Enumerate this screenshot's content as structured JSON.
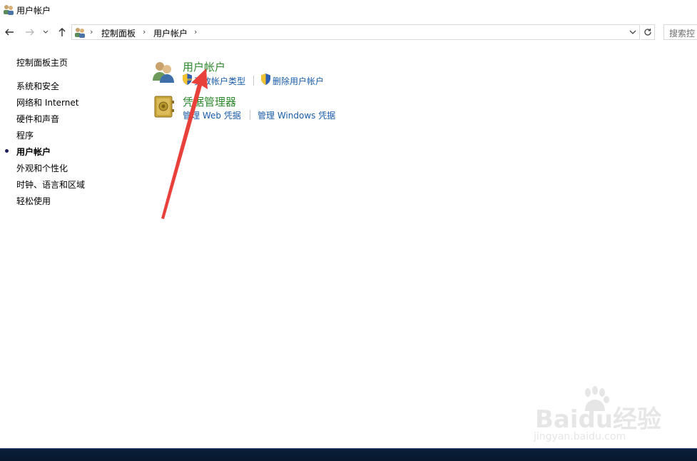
{
  "window": {
    "title": "用户帐户"
  },
  "address": {
    "crumbs": [
      "控制面板",
      "用户帐户"
    ]
  },
  "search": {
    "placeholder": "搜索控"
  },
  "sidebar": {
    "home": "控制面板主页",
    "items": [
      {
        "label": "系统和安全",
        "active": false
      },
      {
        "label": "网络和 Internet",
        "active": false
      },
      {
        "label": "硬件和声音",
        "active": false
      },
      {
        "label": "程序",
        "active": false
      },
      {
        "label": "用户帐户",
        "active": true
      },
      {
        "label": "外观和个性化",
        "active": false
      },
      {
        "label": "时钟、语言和区域",
        "active": false
      },
      {
        "label": "轻松使用",
        "active": false
      }
    ]
  },
  "categories": [
    {
      "title": "用户帐户",
      "icon": "users-icon",
      "links": [
        {
          "label": "更改帐户类型",
          "icon": "uac-shield-icon"
        },
        {
          "label": "删除用户帐户",
          "icon": "uac-shield-icon"
        }
      ]
    },
    {
      "title": "凭据管理器",
      "icon": "credential-vault-icon",
      "links": [
        {
          "label": "管理 Web 凭据"
        },
        {
          "label": "管理 Windows 凭据"
        }
      ]
    }
  ],
  "watermark": {
    "brand": "Baidu经验",
    "url": "jingyan.baidu.com"
  },
  "colors": {
    "category_title": "#2f8a2f",
    "link": "#1a5ca8",
    "annotation_arrow": "#e8413c",
    "taskbar": "#0a1f3a"
  }
}
